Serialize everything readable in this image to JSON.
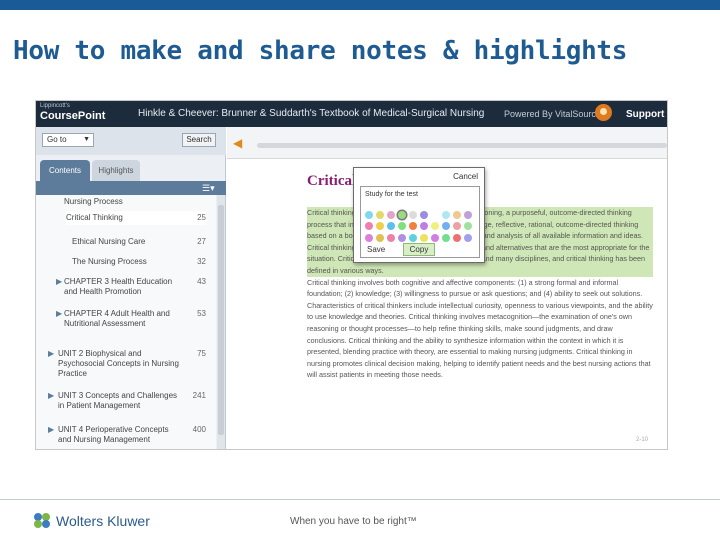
{
  "slide": {
    "title": "How to make and share notes & highlights"
  },
  "app": {
    "logo_small": "Lippincott's",
    "logo": "CoursePoint",
    "book_title": "Hinkle & Cheever: Brunner & Suddarth's Textbook of Medical-Surgical Nursing",
    "powered_by": "Powered By VitalSource",
    "support": "Support"
  },
  "sidebar": {
    "go_label": "Go to",
    "search_label": "Search",
    "tabs": [
      {
        "label": "Contents",
        "active": true
      },
      {
        "label": "Highlights",
        "active": false
      }
    ],
    "toc": [
      {
        "label": "Nursing Process",
        "page": ""
      },
      {
        "label": "Critical Thinking",
        "page": "25"
      },
      {
        "label": "Ethical Nursing Care",
        "page": "27"
      },
      {
        "label": "The Nursing Process",
        "page": "32"
      },
      {
        "label": "CHAPTER 3 Health Education and Health Promotion",
        "page": "43"
      },
      {
        "label": "CHAPTER 4 Adult Health and Nutritional Assessment",
        "page": "53"
      },
      {
        "label": "UNIT 2 Biophysical and Psychosocial Concepts in Nursing Practice",
        "page": "75"
      },
      {
        "label": "UNIT 3 Concepts and Challenges in Patient Management",
        "page": "241"
      },
      {
        "label": "UNIT 4 Perioperative Concepts and Nursing Management",
        "page": "400"
      }
    ]
  },
  "reader": {
    "chapter_heading": "Critical Thinking",
    "page_number": "2-10",
    "paragraphs": [
      "Critical thinking is a cognitive process that involves reasoning, a purposeful, outcome-directed thinking process that involves reasoning and the use of knowledge, reflective, rational, outcome-directed thinking based on a body of knowledge, as well as examination and analysis of all available information and ideas. Critical thinking leads to the formulation of conclusions and alternatives that are the most appropriate for the situation. Critical thinking underlies all nursing practice and many disciplines, and critical thinking has been defined in various ways.",
      "Critical thinking involves both cognitive and affective components: (1) a strong formal and informal foundation; (2) knowledge; (3) willingness to pursue or ask questions; and (4) ability to seek out solutions. Characteristics of critical thinkers include intellectual curiosity, openness to various viewpoints, and the ability to use knowledge and theories. Critical thinking involves metacognition—the examination of one's own reasoning or thought processes—to help refine thinking skills, make sound judgments, and draw conclusions. Critical thinking and the ability to synthesize information within the context in which it is presented, blending practice with theory, are essential to making nursing judgments. Critical thinking in nursing promotes clinical decision making, helping to identify patient needs and the best nursing actions that will assist patients in meeting those needs."
    ]
  },
  "note_popup": {
    "cancel": "Cancel",
    "note_text": "Study for the test",
    "save": "Save",
    "copy": "Copy",
    "swatches": [
      "#7fd8f0",
      "#e3d96b",
      "#e6a3c8",
      "#9ddb7e",
      "#dcdcdc",
      "#9b8ee0",
      "#ffffff",
      "#b0e6f0",
      "#f0c890",
      "#c0a0d8",
      "#f07fb0",
      "#f0d04a",
      "#5cc0ec",
      "#7fe07f",
      "#f07f40",
      "#c07fe0",
      "#f0f07f",
      "#70b0f0",
      "#f0a0a0",
      "#a0e0a0",
      "#e07fd8",
      "#e0c050",
      "#f080a8",
      "#b090e0",
      "#60d0e0",
      "#f0e060",
      "#d080e0",
      "#70e090",
      "#f07070",
      "#a0a0f0"
    ]
  },
  "footer": {
    "company": "Wolters Kluwer",
    "tagline": "When you have to be right™"
  },
  "colors": {
    "title_blue": "#1f5b93",
    "header_dark": "#1d2c3d",
    "chapter_magenta": "#8a1e6e",
    "highlight_green": "#cfe7b6"
  }
}
